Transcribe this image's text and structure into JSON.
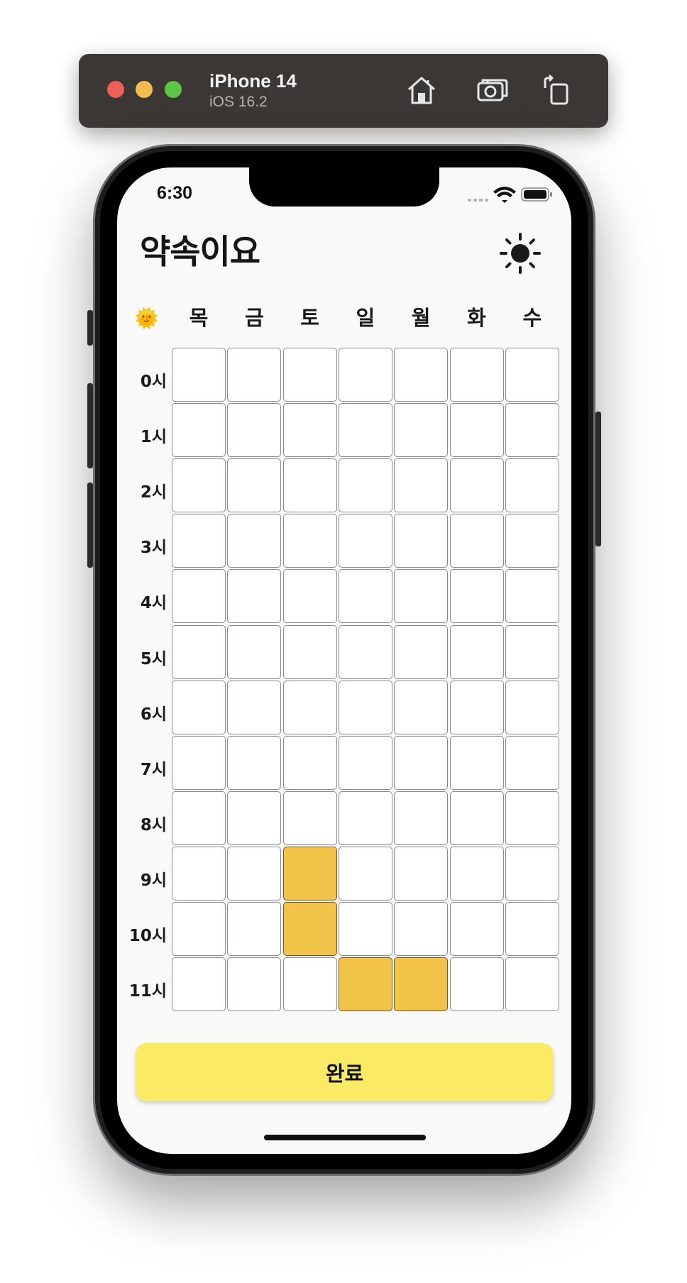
{
  "simulator": {
    "device_name": "iPhone 14",
    "os_version": "iOS 16.2",
    "toolbar_icons": [
      "home-icon",
      "screenshot-icon",
      "rotate-icon"
    ]
  },
  "status_bar": {
    "time": "6:30",
    "icons": [
      "signal-icon",
      "wifi-icon",
      "battery-icon"
    ]
  },
  "app": {
    "title": "약속이요",
    "theme_toggle_icon": "sun-icon"
  },
  "grid": {
    "corner_icon": "🌞",
    "days": [
      "목",
      "금",
      "토",
      "일",
      "월",
      "화",
      "수"
    ],
    "hours": [
      "0시",
      "1시",
      "2시",
      "3시",
      "4시",
      "5시",
      "6시",
      "7시",
      "8시",
      "9시",
      "10시",
      "11시"
    ],
    "selected": [
      {
        "hour": "9시",
        "day": "토"
      },
      {
        "hour": "10시",
        "day": "토"
      },
      {
        "hour": "11시",
        "day": "일"
      },
      {
        "hour": "11시",
        "day": "월"
      }
    ],
    "selected_color": "#f2c349",
    "empty_color": "#ffffff"
  },
  "done_button": {
    "label": "완료",
    "color": "#fbea63"
  }
}
